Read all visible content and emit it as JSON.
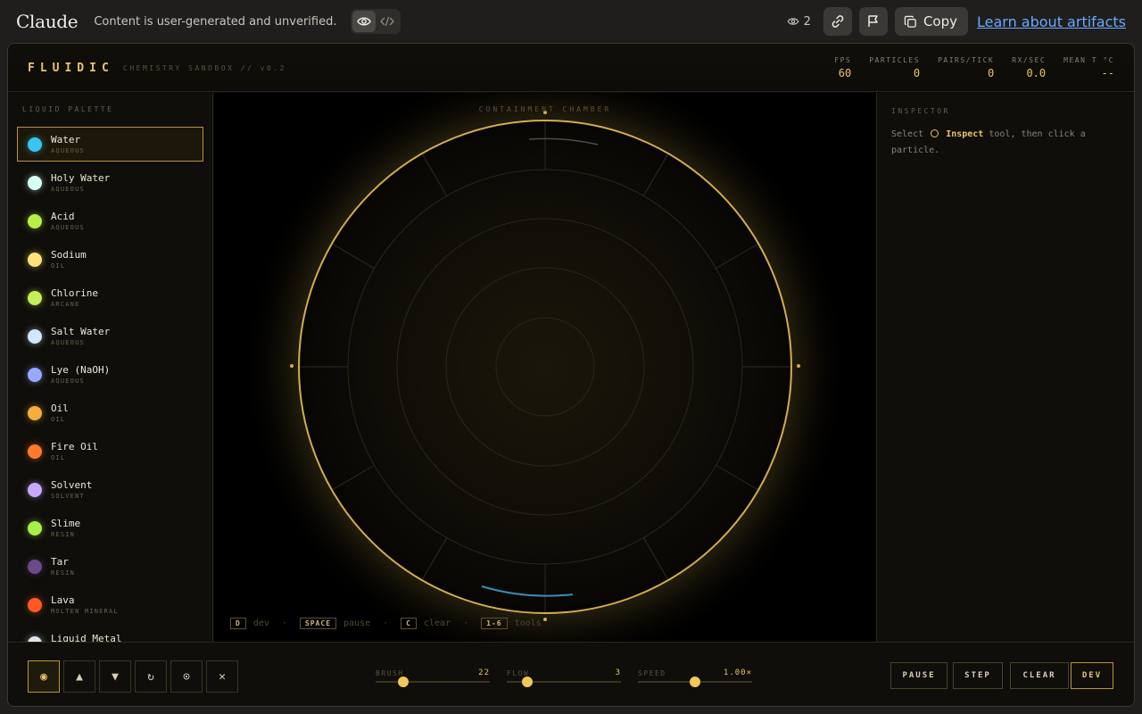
{
  "topbar": {
    "brand": "Claude",
    "notice": "Content is user-generated and unverified.",
    "view_count": "2",
    "copy_label": "Copy",
    "learn_label": "Learn about artifacts"
  },
  "app": {
    "logo": "FLUIDIC",
    "subtitle": "CHEMISTRY SANDBOX // v0.2",
    "stats": [
      {
        "label": "FPS",
        "value": "60"
      },
      {
        "label": "PARTICLES",
        "value": "0"
      },
      {
        "label": "PAIRS/TICK",
        "value": "0"
      },
      {
        "label": "RX/SEC",
        "value": "0.0"
      },
      {
        "label": "MEAN T °C",
        "value": "--"
      }
    ]
  },
  "palette": {
    "title": "LIQUID PALETTE",
    "selected_index": 0,
    "items": [
      {
        "name": "Water",
        "type": "AQUEOUS",
        "color": "#3cc3f2"
      },
      {
        "name": "Holy Water",
        "type": "AQUEOUS",
        "color": "#d8fff4"
      },
      {
        "name": "Acid",
        "type": "AQUEOUS",
        "color": "#b8f04a"
      },
      {
        "name": "Sodium",
        "type": "OIL",
        "color": "#ffe27a"
      },
      {
        "name": "Chlorine",
        "type": "ARCANE",
        "color": "#c4ef5a"
      },
      {
        "name": "Salt Water",
        "type": "AQUEOUS",
        "color": "#cfe8ff"
      },
      {
        "name": "Lye (NaOH)",
        "type": "AQUEOUS",
        "color": "#98a8ff"
      },
      {
        "name": "Oil",
        "type": "OIL",
        "color": "#f7ad3c"
      },
      {
        "name": "Fire Oil",
        "type": "OIL",
        "color": "#ff7a2a"
      },
      {
        "name": "Solvent",
        "type": "SOLVENT",
        "color": "#c9a8ff"
      },
      {
        "name": "Slime",
        "type": "RESIN",
        "color": "#a6f04a"
      },
      {
        "name": "Tar",
        "type": "RESIN",
        "color": "#6a4a8a"
      },
      {
        "name": "Lava",
        "type": "MOLTEN MINERAL",
        "color": "#ff5a24"
      },
      {
        "name": "Liquid Metal",
        "type": "",
        "color": "#dfe6ee"
      }
    ]
  },
  "chamber": {
    "title": "CONTAINMENT CHAMBER",
    "keys": [
      {
        "key": "D",
        "label": "dev"
      },
      {
        "key": "SPACE",
        "label": "pause"
      },
      {
        "key": "C",
        "label": "clear"
      },
      {
        "key": "1-6",
        "label": "tools"
      }
    ]
  },
  "inspector": {
    "title": "INSPECTOR",
    "text_before": "Select",
    "tool_name": "Inspect",
    "text_after": "tool, then click a particle."
  },
  "toolbar": {
    "tools": [
      {
        "icon": "pour-icon",
        "glyph": "◉",
        "active": true
      },
      {
        "icon": "heat-icon",
        "glyph": "▲",
        "active": false
      },
      {
        "icon": "cool-icon",
        "glyph": "▼",
        "active": false
      },
      {
        "icon": "stir-icon",
        "glyph": "↻",
        "active": false
      },
      {
        "icon": "inspect-icon",
        "glyph": "⊙",
        "active": false
      },
      {
        "icon": "erase-icon",
        "glyph": "✕",
        "active": false
      }
    ],
    "sliders": [
      {
        "label": "BRUSH",
        "value": "22",
        "fraction": 0.24
      },
      {
        "label": "FLOW",
        "value": "3",
        "fraction": 0.18
      },
      {
        "label": "SPEED",
        "value": "1.00×",
        "fraction": 0.5
      }
    ],
    "actions": [
      {
        "label": "PAUSE",
        "active": false
      },
      {
        "label": "STEP",
        "active": false
      },
      {
        "label": "CLEAR",
        "active": false
      },
      {
        "label": "DEV",
        "active": true
      }
    ]
  }
}
